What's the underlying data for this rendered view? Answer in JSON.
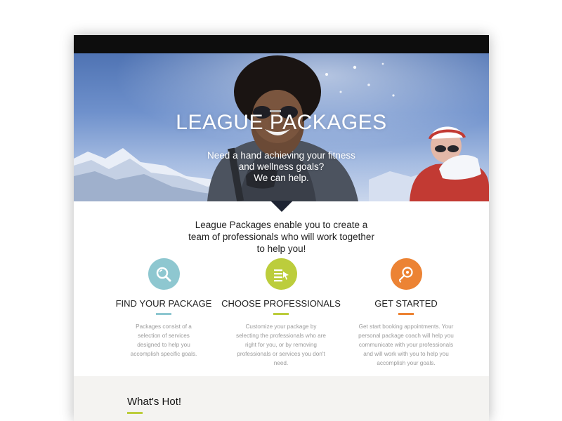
{
  "hero": {
    "title": "LEAGUE PACKAGES",
    "subtitle_lines": [
      "Need a hand achieving your fitness",
      "and wellness goals?",
      "We can help."
    ]
  },
  "intro": {
    "lines": [
      "League Packages enable you to create a",
      "team of professionals who will work together",
      "to help you!"
    ]
  },
  "features": [
    {
      "title": "FIND YOUR PACKAGE",
      "icon": "magnifier-icon",
      "color": "#8ec7d0",
      "description_lines": [
        "Packages consist of a",
        "selection of services",
        "designed to help you",
        "accomplish specific goals."
      ]
    },
    {
      "title": "CHOOSE PROFESSIONALS",
      "icon": "list-cursor-icon",
      "color": "#bccd3c",
      "description_lines": [
        "Customize your package by",
        "selecting the professionals who are",
        "right for you, or by removing",
        "professionals or services you don't",
        "need."
      ]
    },
    {
      "title": "GET STARTED",
      "icon": "whistle-icon",
      "color": "#ec8334",
      "description_lines": [
        "Get start booking appointments. Your",
        "personal package coach will help you",
        "communicate with your professionals",
        "and will work with you to help you",
        "accomplish your goals."
      ]
    }
  ],
  "whats_hot": {
    "title": "What's Hot!",
    "accent_color": "#bccd3c"
  }
}
